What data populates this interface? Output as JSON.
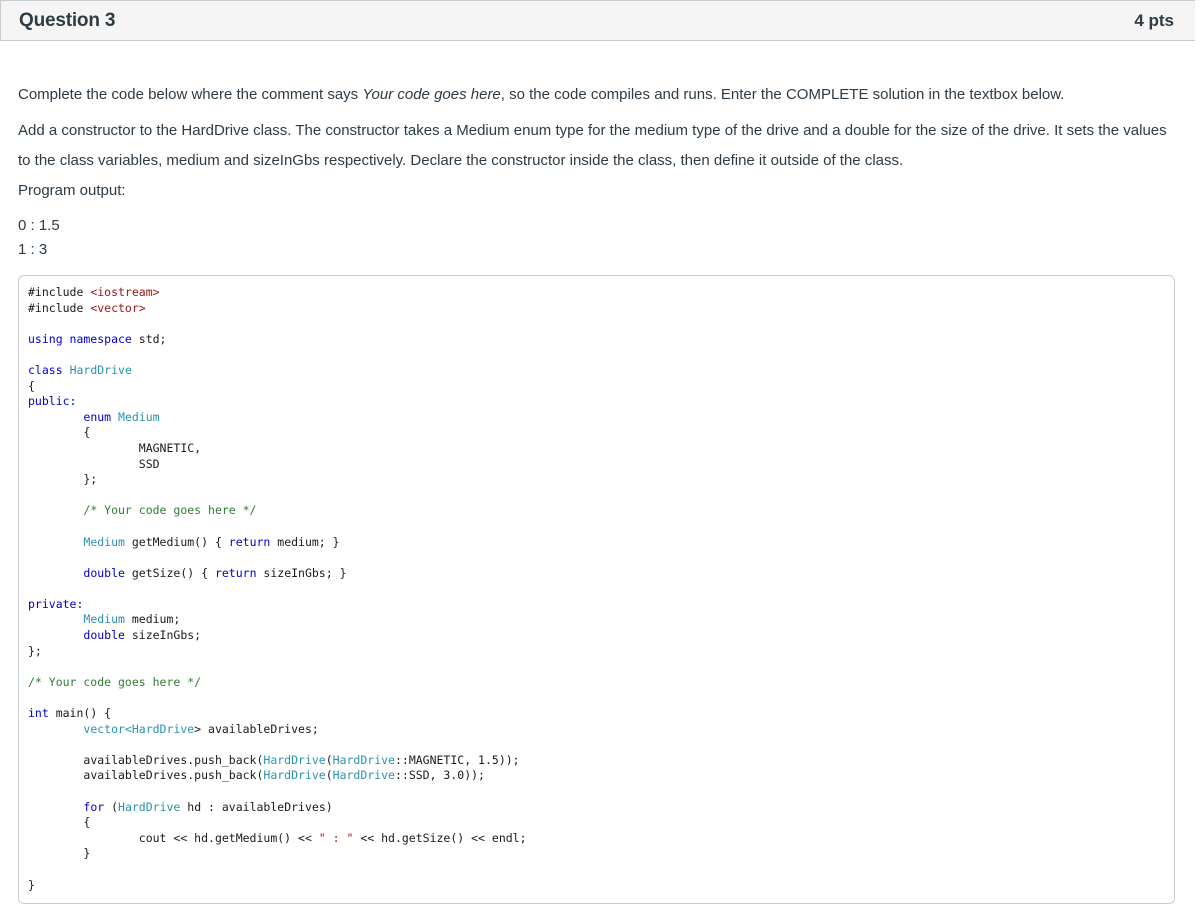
{
  "question": {
    "title": "Question 3",
    "points": "4 pts"
  },
  "prose": {
    "p1_before": "Complete the code below where the comment says ",
    "p1_italic": "Your code goes here",
    "p1_after": ", so the code compiles and runs. Enter the COMPLETE solution in the textbox below.",
    "p2": "Add a constructor to the HardDrive class. The constructor takes a Medium enum type for the medium type of the drive and a double for the size of the drive. It sets the values to the class variables, medium and sizeInGbs respectively. Declare the constructor inside the class, then define it outside of the class.",
    "p3": "Program output:"
  },
  "output": {
    "line1": "0 : 1.5",
    "line2": "1 : 3"
  },
  "code": {
    "include1_kw": "#include ",
    "include1_hdr": "<iostream>",
    "include2_kw": "#include ",
    "include2_hdr": "<vector>",
    "using_kw": "using namespace",
    "using_rest": " std;",
    "class_kw": "class",
    "class_name": "HardDrive",
    "public_kw": "public:",
    "enum_kw": "enum",
    "enum_name": "Medium",
    "enum_val1": "MAGNETIC,",
    "enum_val2": "SSD",
    "comment_inside": "/* Your code goes here */",
    "getMedium_type": "Medium",
    "getMedium_sig": " getMedium() { ",
    "return_kw1": "return",
    "getMedium_body": " medium; }",
    "getSize_type": "double",
    "getSize_sig": " getSize() { ",
    "return_kw2": "return",
    "getSize_body": " sizeInGbs; }",
    "private_kw": "private:",
    "member1_type": "Medium",
    "member1_name": " medium;",
    "member2_type": "double",
    "member2_name": " sizeInGbs;",
    "class_end": "};",
    "comment_outside": "/* Your code goes here */",
    "main_type": "int",
    "main_sig": " main() {",
    "vector_kw": "vector<",
    "vector_type": "HardDrive",
    "vector_rest": "> availableDrives;",
    "push1_start": "availableDrives.push_back(",
    "push1_ctor": "HardDrive",
    "push1_paren": "(",
    "push1_scope": "HardDrive",
    "push1_rest": "::MAGNETIC, 1.5));",
    "push2_start": "availableDrives.push_back(",
    "push2_ctor": "HardDrive",
    "push2_paren": "(",
    "push2_scope": "HardDrive",
    "push2_rest": "::SSD, 3.0));",
    "for_kw": "for",
    "for_paren": " (",
    "for_type": "HardDrive",
    "for_rest": " hd : availableDrives)",
    "cout_start": "cout << hd.getMedium() << ",
    "cout_str": "\" : \"",
    "cout_end": " << hd.getSize() << endl;",
    "main_end": "}"
  },
  "colors": {
    "keyword": "#0000cc",
    "type": "#2b91af",
    "string": "#a31515",
    "header_bg": "#f5f5f5",
    "border": "#c7cdd1",
    "text": "#2d3b45"
  }
}
